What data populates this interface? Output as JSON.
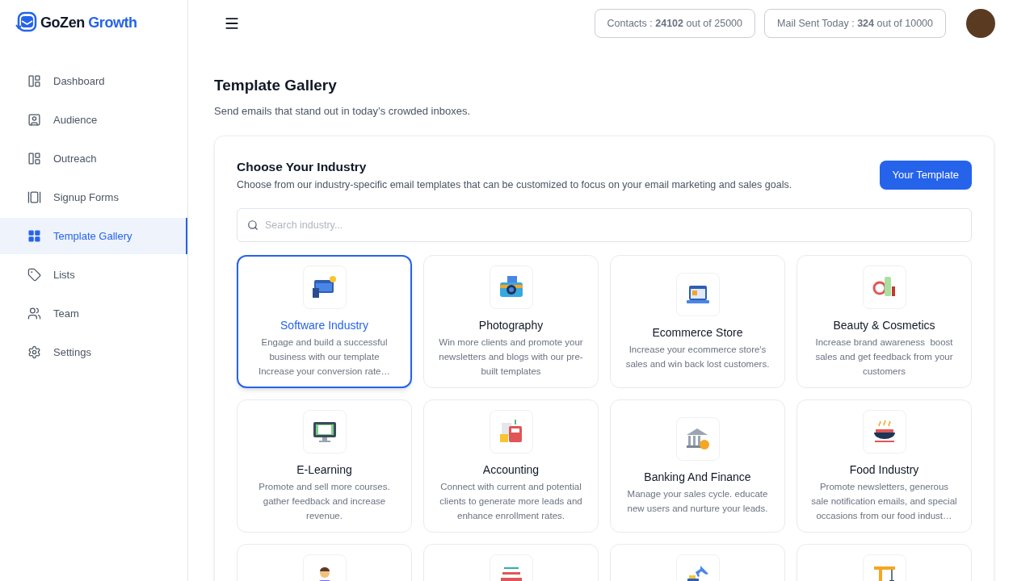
{
  "brand": {
    "part1": "GoZen",
    "part2": "Growth"
  },
  "sidebar": {
    "items": [
      {
        "label": "Dashboard",
        "selected": false
      },
      {
        "label": "Audience",
        "selected": false
      },
      {
        "label": "Outreach",
        "selected": false
      },
      {
        "label": "Signup Forms",
        "selected": false
      },
      {
        "label": "Template Gallery",
        "selected": true
      },
      {
        "label": "Lists",
        "selected": false
      },
      {
        "label": "Team",
        "selected": false
      },
      {
        "label": "Settings",
        "selected": false
      }
    ]
  },
  "header": {
    "stats": [
      "Contacts : **24102** out of 25000",
      "Mail Sent Today : **324** out of 10000"
    ]
  },
  "page": {
    "title": "Template Gallery",
    "subtitle": "Send emails that stand out in today’s crowded inboxes."
  },
  "panel": {
    "title": "Choose Your Industry",
    "description": "Choose from our industry-specific email templates that can be customized to focus on your email marketing and sales goals.",
    "button": "Your Template",
    "search": {
      "placeholder": "Search industry..."
    }
  },
  "cards": [
    {
      "kind": "full",
      "title": "Software Industry",
      "description": "Engage and build a successful business with our template Increase your conversion rate…",
      "selected": true
    },
    {
      "kind": "full",
      "title": "Photography",
      "description": "Win more clients and promote your newsletters and blogs with our pre-built templates",
      "selected": false
    },
    {
      "kind": "full",
      "title": "Ecommerce Store",
      "description": "Increase your ecommerce store's sales and win back lost customers.",
      "selected": false
    },
    {
      "kind": "full",
      "title": "Beauty & Cosmetics",
      "description": "Increase brand awareness  boost sales and get feedback from your customers",
      "selected": false
    },
    {
      "kind": "full",
      "title": "E-Learning",
      "description": "Promote and sell more courses. gather feedback and increase revenue.",
      "selected": false
    },
    {
      "kind": "full",
      "title": "Accounting",
      "description": "Connect with current and potential clients to generate more leads and enhance enrollment rates.",
      "selected": false
    },
    {
      "kind": "full",
      "title": "Banking And Finance",
      "description": "Manage your sales cycle. educate new users and nurture your leads.",
      "selected": false
    },
    {
      "kind": "full",
      "title": "Food Industry",
      "description": "Promote newsletters, generous sale notification emails, and special occasions from our food indust…",
      "selected": false
    },
    {
      "kind": "partial",
      "selected": false
    },
    {
      "kind": "partial",
      "selected": false
    },
    {
      "kind": "partial",
      "selected": false
    },
    {
      "kind": "partial",
      "selected": false
    }
  ]
}
